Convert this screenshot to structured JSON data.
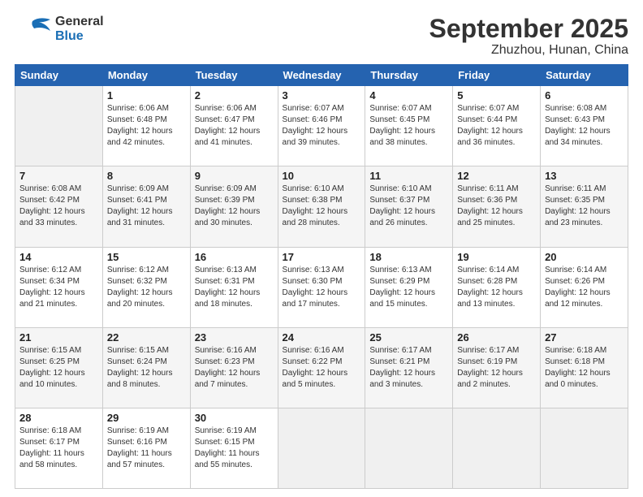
{
  "header": {
    "logo_line1": "General",
    "logo_line2": "Blue",
    "title": "September 2025",
    "subtitle": "Zhuzhou, Hunan, China"
  },
  "days_of_week": [
    "Sunday",
    "Monday",
    "Tuesday",
    "Wednesday",
    "Thursday",
    "Friday",
    "Saturday"
  ],
  "weeks": [
    [
      {
        "day": "",
        "info": ""
      },
      {
        "day": "1",
        "info": "Sunrise: 6:06 AM\nSunset: 6:48 PM\nDaylight: 12 hours\nand 42 minutes."
      },
      {
        "day": "2",
        "info": "Sunrise: 6:06 AM\nSunset: 6:47 PM\nDaylight: 12 hours\nand 41 minutes."
      },
      {
        "day": "3",
        "info": "Sunrise: 6:07 AM\nSunset: 6:46 PM\nDaylight: 12 hours\nand 39 minutes."
      },
      {
        "day": "4",
        "info": "Sunrise: 6:07 AM\nSunset: 6:45 PM\nDaylight: 12 hours\nand 38 minutes."
      },
      {
        "day": "5",
        "info": "Sunrise: 6:07 AM\nSunset: 6:44 PM\nDaylight: 12 hours\nand 36 minutes."
      },
      {
        "day": "6",
        "info": "Sunrise: 6:08 AM\nSunset: 6:43 PM\nDaylight: 12 hours\nand 34 minutes."
      }
    ],
    [
      {
        "day": "7",
        "info": "Sunrise: 6:08 AM\nSunset: 6:42 PM\nDaylight: 12 hours\nand 33 minutes."
      },
      {
        "day": "8",
        "info": "Sunrise: 6:09 AM\nSunset: 6:41 PM\nDaylight: 12 hours\nand 31 minutes."
      },
      {
        "day": "9",
        "info": "Sunrise: 6:09 AM\nSunset: 6:39 PM\nDaylight: 12 hours\nand 30 minutes."
      },
      {
        "day": "10",
        "info": "Sunrise: 6:10 AM\nSunset: 6:38 PM\nDaylight: 12 hours\nand 28 minutes."
      },
      {
        "day": "11",
        "info": "Sunrise: 6:10 AM\nSunset: 6:37 PM\nDaylight: 12 hours\nand 26 minutes."
      },
      {
        "day": "12",
        "info": "Sunrise: 6:11 AM\nSunset: 6:36 PM\nDaylight: 12 hours\nand 25 minutes."
      },
      {
        "day": "13",
        "info": "Sunrise: 6:11 AM\nSunset: 6:35 PM\nDaylight: 12 hours\nand 23 minutes."
      }
    ],
    [
      {
        "day": "14",
        "info": "Sunrise: 6:12 AM\nSunset: 6:34 PM\nDaylight: 12 hours\nand 21 minutes."
      },
      {
        "day": "15",
        "info": "Sunrise: 6:12 AM\nSunset: 6:32 PM\nDaylight: 12 hours\nand 20 minutes."
      },
      {
        "day": "16",
        "info": "Sunrise: 6:13 AM\nSunset: 6:31 PM\nDaylight: 12 hours\nand 18 minutes."
      },
      {
        "day": "17",
        "info": "Sunrise: 6:13 AM\nSunset: 6:30 PM\nDaylight: 12 hours\nand 17 minutes."
      },
      {
        "day": "18",
        "info": "Sunrise: 6:13 AM\nSunset: 6:29 PM\nDaylight: 12 hours\nand 15 minutes."
      },
      {
        "day": "19",
        "info": "Sunrise: 6:14 AM\nSunset: 6:28 PM\nDaylight: 12 hours\nand 13 minutes."
      },
      {
        "day": "20",
        "info": "Sunrise: 6:14 AM\nSunset: 6:26 PM\nDaylight: 12 hours\nand 12 minutes."
      }
    ],
    [
      {
        "day": "21",
        "info": "Sunrise: 6:15 AM\nSunset: 6:25 PM\nDaylight: 12 hours\nand 10 minutes."
      },
      {
        "day": "22",
        "info": "Sunrise: 6:15 AM\nSunset: 6:24 PM\nDaylight: 12 hours\nand 8 minutes."
      },
      {
        "day": "23",
        "info": "Sunrise: 6:16 AM\nSunset: 6:23 PM\nDaylight: 12 hours\nand 7 minutes."
      },
      {
        "day": "24",
        "info": "Sunrise: 6:16 AM\nSunset: 6:22 PM\nDaylight: 12 hours\nand 5 minutes."
      },
      {
        "day": "25",
        "info": "Sunrise: 6:17 AM\nSunset: 6:21 PM\nDaylight: 12 hours\nand 3 minutes."
      },
      {
        "day": "26",
        "info": "Sunrise: 6:17 AM\nSunset: 6:19 PM\nDaylight: 12 hours\nand 2 minutes."
      },
      {
        "day": "27",
        "info": "Sunrise: 6:18 AM\nSunset: 6:18 PM\nDaylight: 12 hours\nand 0 minutes."
      }
    ],
    [
      {
        "day": "28",
        "info": "Sunrise: 6:18 AM\nSunset: 6:17 PM\nDaylight: 11 hours\nand 58 minutes."
      },
      {
        "day": "29",
        "info": "Sunrise: 6:19 AM\nSunset: 6:16 PM\nDaylight: 11 hours\nand 57 minutes."
      },
      {
        "day": "30",
        "info": "Sunrise: 6:19 AM\nSunset: 6:15 PM\nDaylight: 11 hours\nand 55 minutes."
      },
      {
        "day": "",
        "info": ""
      },
      {
        "day": "",
        "info": ""
      },
      {
        "day": "",
        "info": ""
      },
      {
        "day": "",
        "info": ""
      }
    ]
  ]
}
